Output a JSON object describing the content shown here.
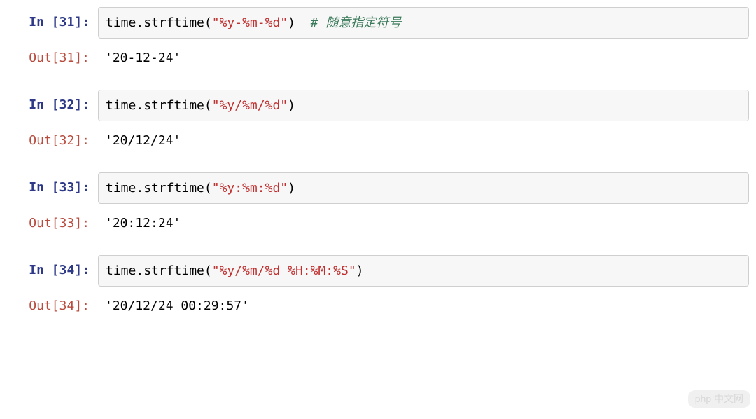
{
  "cells": [
    {
      "in_label": "In [31]:",
      "out_label": "Out[31]:",
      "code_prefix": "time",
      "code_dot": ".",
      "code_func": "strftime",
      "code_open": "(",
      "code_str": "\"%y-%m-%d\"",
      "code_close": ")",
      "code_comment": "  # 随意指定符号",
      "output": "'20-12-24'"
    },
    {
      "in_label": "In [32]:",
      "out_label": "Out[32]:",
      "code_prefix": "time",
      "code_dot": ".",
      "code_func": "strftime",
      "code_open": "(",
      "code_str": "\"%y/%m/%d\"",
      "code_close": ")",
      "code_comment": "",
      "output": "'20/12/24'"
    },
    {
      "in_label": "In [33]:",
      "out_label": "Out[33]:",
      "code_prefix": "time",
      "code_dot": ".",
      "code_func": "strftime",
      "code_open": "(",
      "code_str": "\"%y:%m:%d\"",
      "code_close": ")",
      "code_comment": "",
      "output": "'20:12:24'"
    },
    {
      "in_label": "In [34]:",
      "out_label": "Out[34]:",
      "code_prefix": "time",
      "code_dot": ".",
      "code_func": "strftime",
      "code_open": "(",
      "code_str": "\"%y/%m/%d %H:%M:%S\"",
      "code_close": ")",
      "code_comment": "",
      "output": "'20/12/24 00:29:57'"
    }
  ],
  "watermark": "php 中文网"
}
